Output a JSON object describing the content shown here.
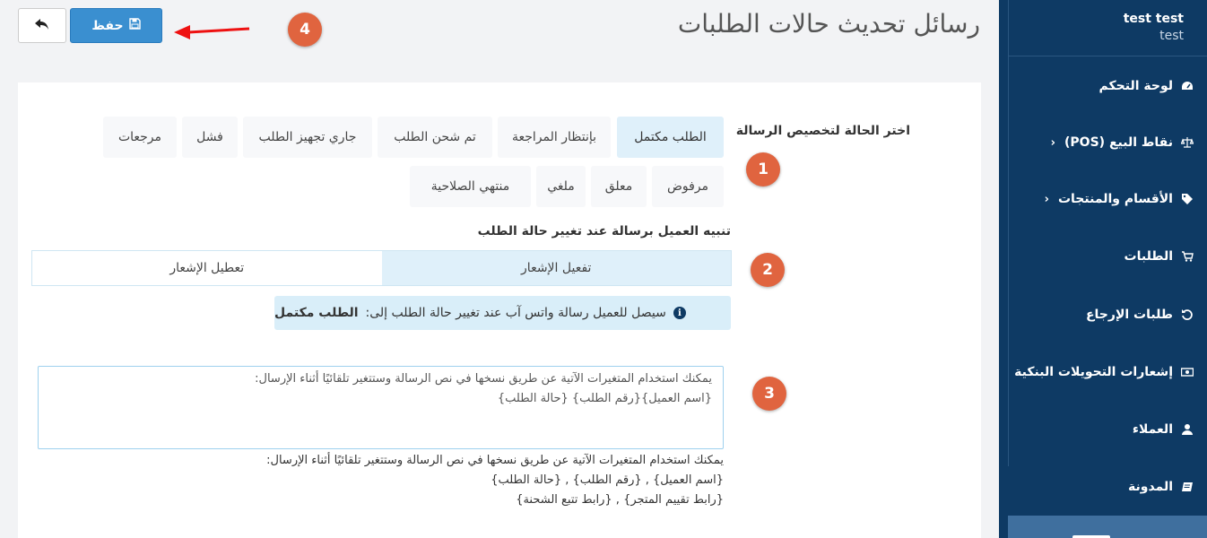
{
  "header": {
    "title": "رسائل تحديث حالات الطلبات",
    "save_label": "حفظ"
  },
  "user": {
    "name": "test test",
    "sub": "test"
  },
  "sidebar": {
    "items": [
      {
        "label": "لوحة التحكم",
        "icon": "dashboard-icon"
      },
      {
        "label": "نقاط البيع (POS)",
        "icon": "scale-icon",
        "chevron": "‹"
      },
      {
        "label": "الأقسام والمنتجات",
        "icon": "tag-icon",
        "chevron": "‹"
      },
      {
        "label": "الطلبات",
        "icon": "cart-icon"
      },
      {
        "label": "طلبات الإرجاع",
        "icon": "undo-icon"
      },
      {
        "label": "إشعارات التحويلات البنكية",
        "icon": "money-icon"
      },
      {
        "label": "العملاء",
        "icon": "user-icon"
      },
      {
        "label": "المدونة",
        "icon": "book-icon"
      }
    ]
  },
  "annotations": {
    "b1": "1",
    "b2": "2",
    "b3": "3",
    "b4": "4"
  },
  "form": {
    "choose_label": "اختر الحالة لتخصيص الرسالة",
    "statuses_row1": [
      "الطلب مكتمل",
      "بإنتظار المراجعة",
      "تم شحن الطلب",
      "جاري تجهيز الطلب",
      "فشل",
      "مرجعات"
    ],
    "statuses_row2": [
      "مرفوض",
      "معلق",
      "ملغي",
      "منتهي الصلاحية"
    ],
    "selected_status": "الطلب مكتمل",
    "notify_label": "تنبيه العميل برسالة عند تغيير حالة الطلب",
    "enable_label": "تفعيل الإشعار",
    "disable_label": "تعطيل الإشعار",
    "notify_enabled": true,
    "info_text": "سيصل للعميل رسالة واتس آب عند تغيير حالة الطلب إلى:",
    "info_status": "الطلب مكتمل",
    "message_value": "يمكنك استخدام المتغيرات الآتية عن طريق نسخها في نص الرسالة وستتغير تلقائيًا أثناء الإرسال:\n{اسم العميل}{رقم الطلب} {حالة الطلب}",
    "help_line1": "يمكنك استخدام المتغيرات الآتية عن طريق نسخها في نص الرسالة وستتغير تلقائيًا أثناء الإرسال:",
    "help_line2": "{اسم العميل} , {رقم الطلب} , {حالة الطلب}",
    "help_line3": "{رابط تقييم المتجر} , {رابط تتبع الشحنة}"
  },
  "colors": {
    "sidebar_bg": "#0e3a64",
    "primary": "#3a8fd0",
    "badge": "#e0643f",
    "active_bg": "#dff0fa"
  }
}
